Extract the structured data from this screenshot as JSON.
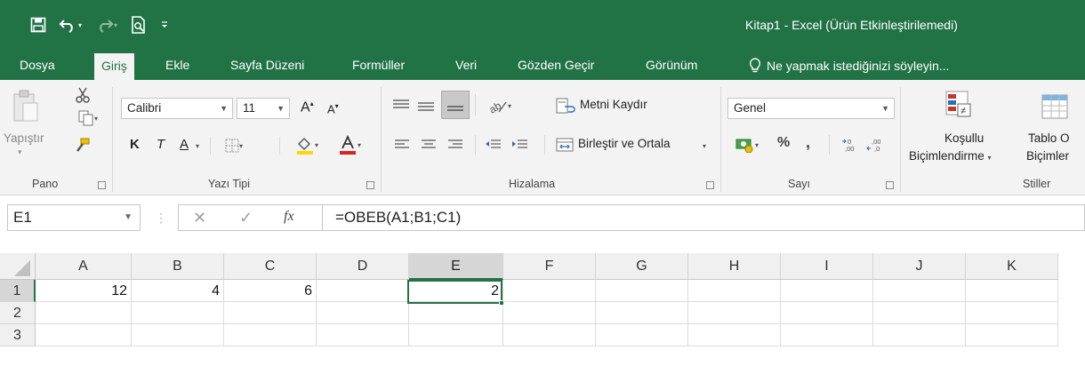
{
  "window": {
    "title": "Kitap1 - Excel (Ürün Etkinleştirilemedi)"
  },
  "quick_access": [
    "save-icon",
    "undo-icon",
    "redo-icon",
    "print-preview-icon",
    "customize-qat-icon"
  ],
  "tabs": [
    {
      "label": "Dosya"
    },
    {
      "label": "Giriş"
    },
    {
      "label": "Ekle"
    },
    {
      "label": "Sayfa Düzeni"
    },
    {
      "label": "Formüller"
    },
    {
      "label": "Veri"
    },
    {
      "label": "Gözden Geçir"
    },
    {
      "label": "Görünüm"
    }
  ],
  "tell_me": "Ne yapmak istediğinizi söyleyin...",
  "ribbon": {
    "clipboard": {
      "paste_label": "Yapıştır",
      "group_label": "Pano"
    },
    "font": {
      "font_name": "Calibri",
      "font_size": "11",
      "bold": "K",
      "italic": "T",
      "underline": "A",
      "grow_font": "A",
      "shrink_font": "A",
      "group_label": "Yazı Tipi"
    },
    "alignment": {
      "wrap_text": "Metni Kaydır",
      "merge_center": "Birleştir ve Ortala",
      "group_label": "Hizalama"
    },
    "number": {
      "format": "Genel",
      "percent": "%",
      "comma": ",",
      "group_label": "Sayı"
    },
    "styles": {
      "conditional_line1": "Koşullu",
      "conditional_line2": "Biçimlendirme",
      "table_line1": "Tablo O",
      "table_line2": "Biçimler",
      "group_label": "Stiller"
    }
  },
  "formula_bar": {
    "name_box": "E1",
    "fx": "fx",
    "formula": "=OBEB(A1;B1;C1)"
  },
  "sheet": {
    "columns": [
      "A",
      "B",
      "C",
      "D",
      "E",
      "F",
      "G",
      "H",
      "I",
      "J",
      "K"
    ],
    "rows": [
      "1",
      "2",
      "3"
    ],
    "cells": [
      [
        "12",
        "4",
        "6",
        "",
        "2",
        "",
        "",
        "",
        "",
        "",
        ""
      ],
      [
        "",
        "",
        "",
        "",
        "",
        "",
        "",
        "",
        "",
        "",
        ""
      ],
      [
        "",
        "",
        "",
        "",
        "",
        "",
        "",
        "",
        "",
        "",
        ""
      ]
    ],
    "selected_cell": "E1"
  },
  "colors": {
    "excel_green": "#217346",
    "ribbon_bg": "#f3f3f3",
    "font_color_accent": "#e02020",
    "highlight_accent": "#ffd800"
  }
}
